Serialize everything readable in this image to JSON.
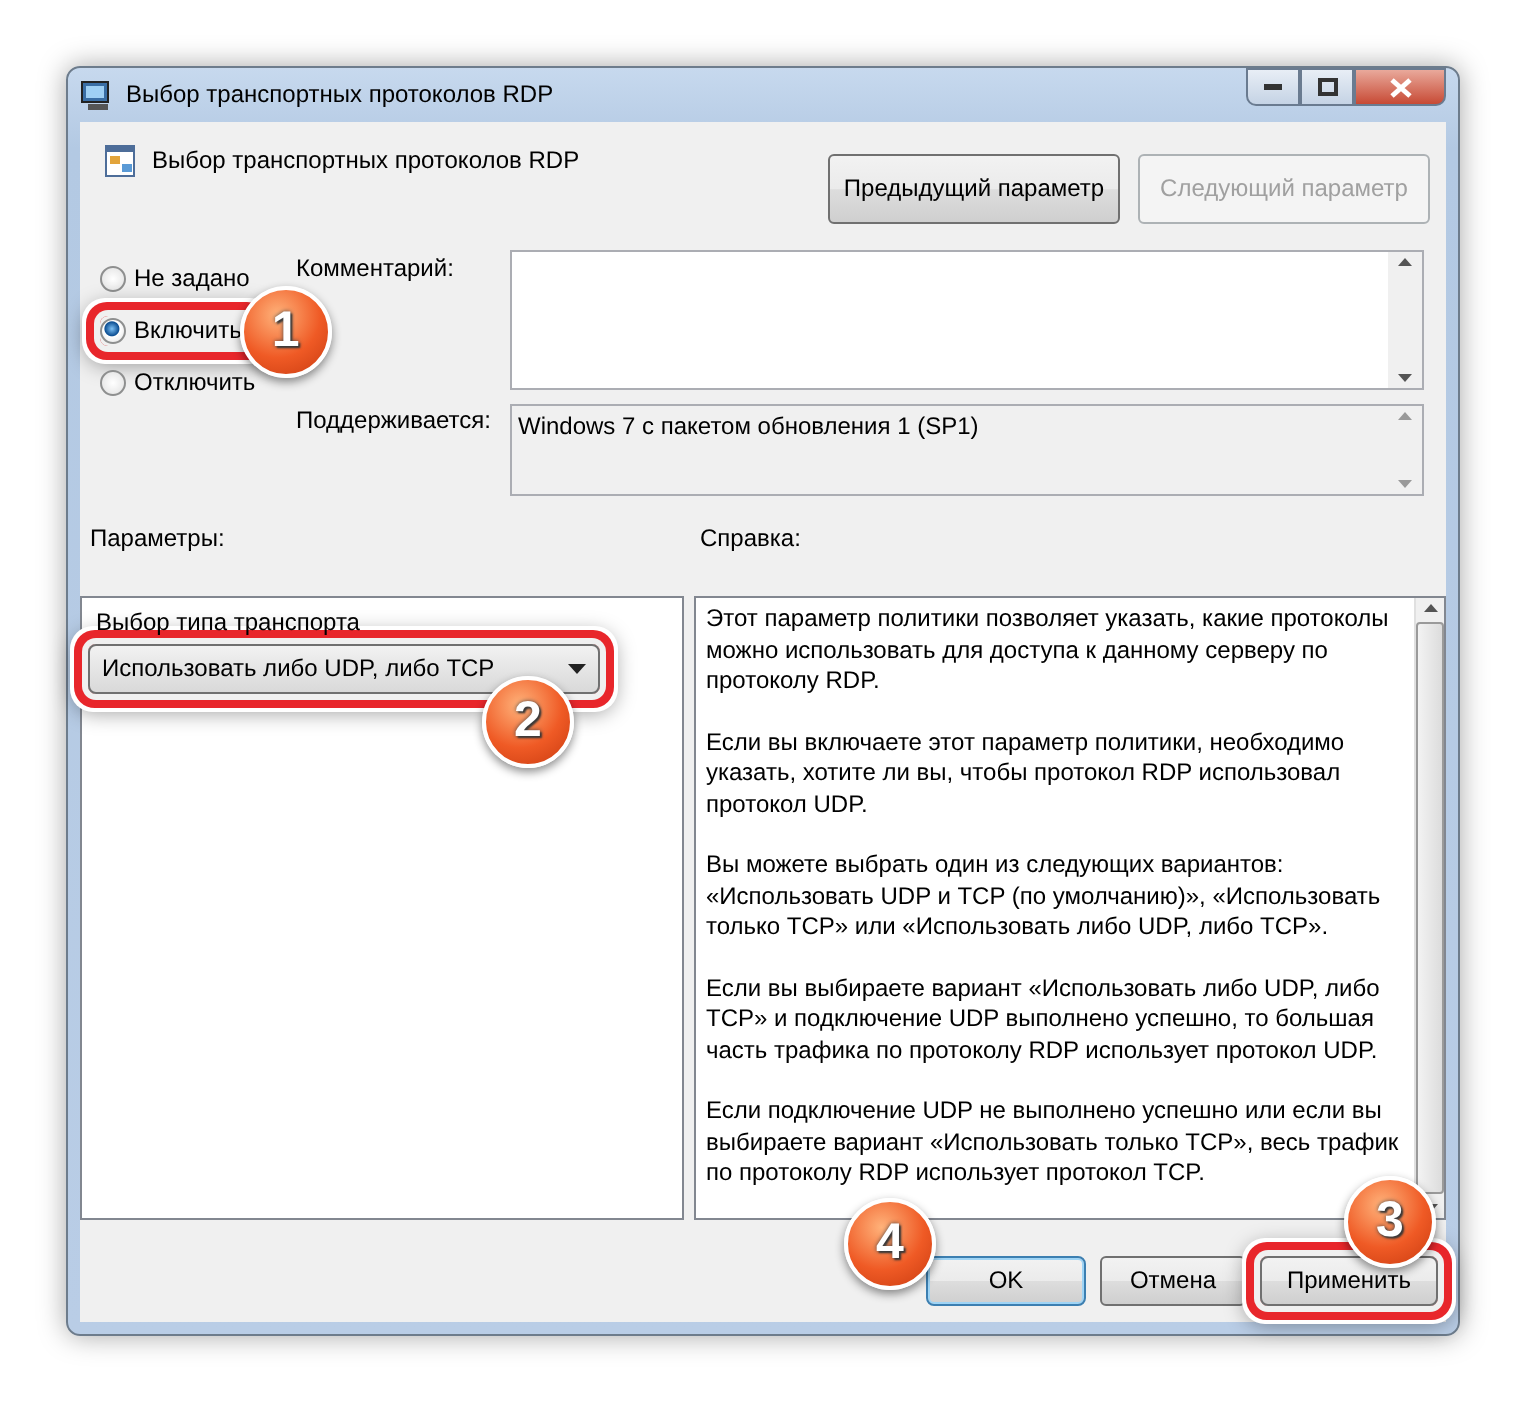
{
  "window": {
    "title": "Выбор транспортных протоколов RDP"
  },
  "header": {
    "title": "Выбор транспортных протоколов RDP"
  },
  "nav_buttons": [
    {
      "label": "Предыдущий параметр",
      "disabled": false
    },
    {
      "label": "Следующий параметр",
      "disabled": true
    }
  ],
  "radios": [
    {
      "label": "Не задано",
      "selected": false
    },
    {
      "label": "Включить",
      "selected": true
    },
    {
      "label": "Отключить",
      "selected": false
    }
  ],
  "comment": {
    "label": "Комментарий:"
  },
  "supported": {
    "label": "Поддерживается:",
    "value": "Windows 7 с пакетом обновления 1 (SP1)"
  },
  "options": {
    "label": "Параметры:",
    "field_label": "Выбор типа транспорта",
    "value": "Использовать либо UDP, либо TCP"
  },
  "help": {
    "label": "Справка:",
    "paragraphs": [
      "Этот параметр политики позволяет указать, какие протоколы можно использовать для доступа к данному серверу по протоколу RDP.",
      "Если вы включаете этот параметр политики, необходимо указать, хотите ли вы, чтобы протокол RDP использовал протокол UDP.",
      "Вы можете выбрать один из следующих вариантов: «Использовать UDP и TCP (по умолчанию)», «Использовать только TCP» или «Использовать либо UDP, либо TCP».",
      "Если вы выбираете вариант «Использовать либо UDP, либо TCP» и подключение UDP выполнено успешно, то большая часть трафика по протоколу RDP использует протокол UDP.",
      "Если подключение UDP не выполнено успешно или если вы выбираете вариант «Использовать только TCP», весь трафик по протоколу RDP использует протокол TCP."
    ]
  },
  "buttons": [
    {
      "label": "OK",
      "default": true
    },
    {
      "label": "Отмена",
      "default": false
    },
    {
      "label": "Применить",
      "default": false
    }
  ],
  "callouts": [
    {
      "number": "1"
    },
    {
      "number": "2"
    },
    {
      "number": "3"
    },
    {
      "number": "4"
    }
  ]
}
